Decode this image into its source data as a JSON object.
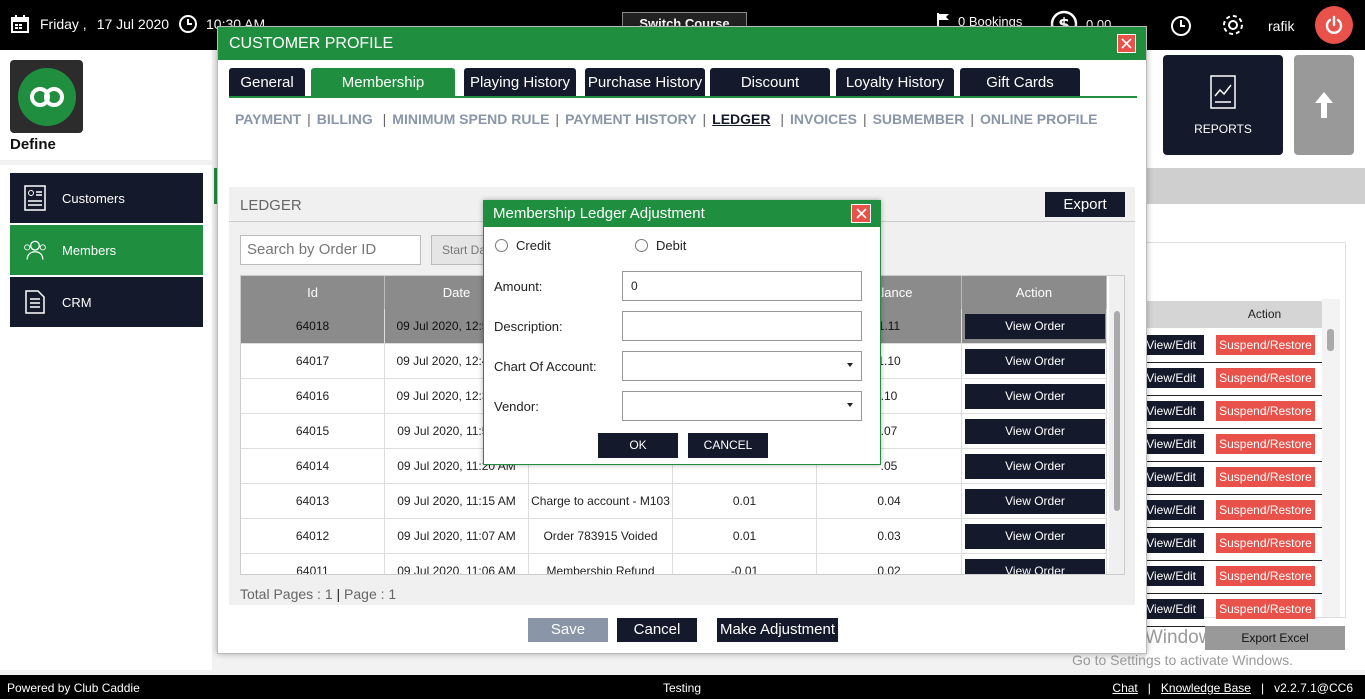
{
  "topbar": {
    "day": "Friday ,",
    "date": "17 Jul 2020",
    "time": "10:30 AM",
    "switch_course": "Switch Course",
    "bookings": "0 Bookings",
    "amount": "0.00",
    "user": "rafik"
  },
  "sidebar": {
    "define_label": "Define",
    "items": [
      {
        "label": "Customers",
        "icon": "customer-card-icon"
      },
      {
        "label": "Members",
        "icon": "members-group-icon"
      },
      {
        "label": "CRM",
        "icon": "crm-doc-icon"
      }
    ]
  },
  "right_panel": {
    "reports_label": "REPORTS",
    "action_header": "Action",
    "view_edit_label": "View/Edit",
    "suspend_label": "Suspend/Restore",
    "export_excel": "Export Excel",
    "watermark_title": "Activate Windows",
    "watermark_sub": "Go to Settings to activate Windows."
  },
  "profile": {
    "title": "CUSTOMER PROFILE",
    "tabs": [
      "General",
      "Membership",
      "Playing History",
      "Purchase History",
      "Discount",
      "Loyalty History",
      "Gift Cards"
    ],
    "subtabs": [
      "PAYMENT",
      "BILLING",
      "MINIMUM SPEND RULE",
      "PAYMENT HISTORY",
      "LEDGER",
      "INVOICES",
      "SUBMEMBER",
      "ONLINE PROFILE"
    ],
    "ledger_title": "LEDGER",
    "export_label": "Export",
    "search_placeholder": "Search by Order ID",
    "start_date_placeholder": "Start Date",
    "columns": [
      "Id",
      "Date",
      "",
      "",
      "Balance",
      "Action"
    ],
    "rows": [
      {
        "id": "64018",
        "date": "09 Jul 2020, 12:59 PM",
        "desc": "",
        "amount": "",
        "balance": "0.11",
        "balance_visible": "1.11",
        "selected": true
      },
      {
        "id": "64017",
        "date": "09 Jul 2020, 12:45 PM",
        "desc": "",
        "amount": "",
        "balance_visible": "1.10"
      },
      {
        "id": "64016",
        "date": "09 Jul 2020, 12:30 PM",
        "desc": "",
        "amount": "",
        "balance_visible": ".10"
      },
      {
        "id": "64015",
        "date": "09 Jul 2020, 11:59 AM",
        "desc": "",
        "amount": "",
        "balance_visible": ".07"
      },
      {
        "id": "64014",
        "date": "09 Jul 2020, 11:20 AM",
        "desc": "",
        "amount": "",
        "balance_visible": ".05"
      },
      {
        "id": "64013",
        "date": "09 Jul 2020, 11:15 AM",
        "desc": "Charge to account - M103",
        "amount": "0.01",
        "balance_visible": "0.04"
      },
      {
        "id": "64012",
        "date": "09 Jul 2020, 11:07 AM",
        "desc": "Order 783915 Voided",
        "amount": "0.01",
        "balance_visible": "0.03"
      },
      {
        "id": "64011",
        "date": "09 Jul 2020, 11:06 AM",
        "desc": "Membership Refund",
        "amount": "-0.01",
        "balance_visible": "0.02"
      }
    ],
    "view_order_label": "View Order",
    "total_pages_label": "Total Pages : 1",
    "page_label": "Page : 1",
    "save_label": "Save",
    "cancel_label": "Cancel",
    "adjust_label": "Make Adjustment"
  },
  "dialog": {
    "title": "Membership Ledger Adjustment",
    "credit_label": "Credit",
    "debit_label": "Debit",
    "amount_label": "Amount:",
    "amount_value": "0",
    "description_label": "Description:",
    "description_value": "",
    "coa_label": "Chart Of Account:",
    "coa_value": "",
    "vendor_label": "Vendor:",
    "vendor_value": "",
    "ok_label": "OK",
    "cancel_label": "CANCEL"
  },
  "footer": {
    "powered_by": "Powered by Club Caddie",
    "environment": "Testing",
    "chat": "Chat",
    "knowledge_base": "Knowledge Base",
    "version": "v2.2.7.1@CC6"
  },
  "colors": {
    "green": "#1f8f3f",
    "navy": "#14192b",
    "red": "#e9524a",
    "grey_header": "#8b8b8b"
  }
}
